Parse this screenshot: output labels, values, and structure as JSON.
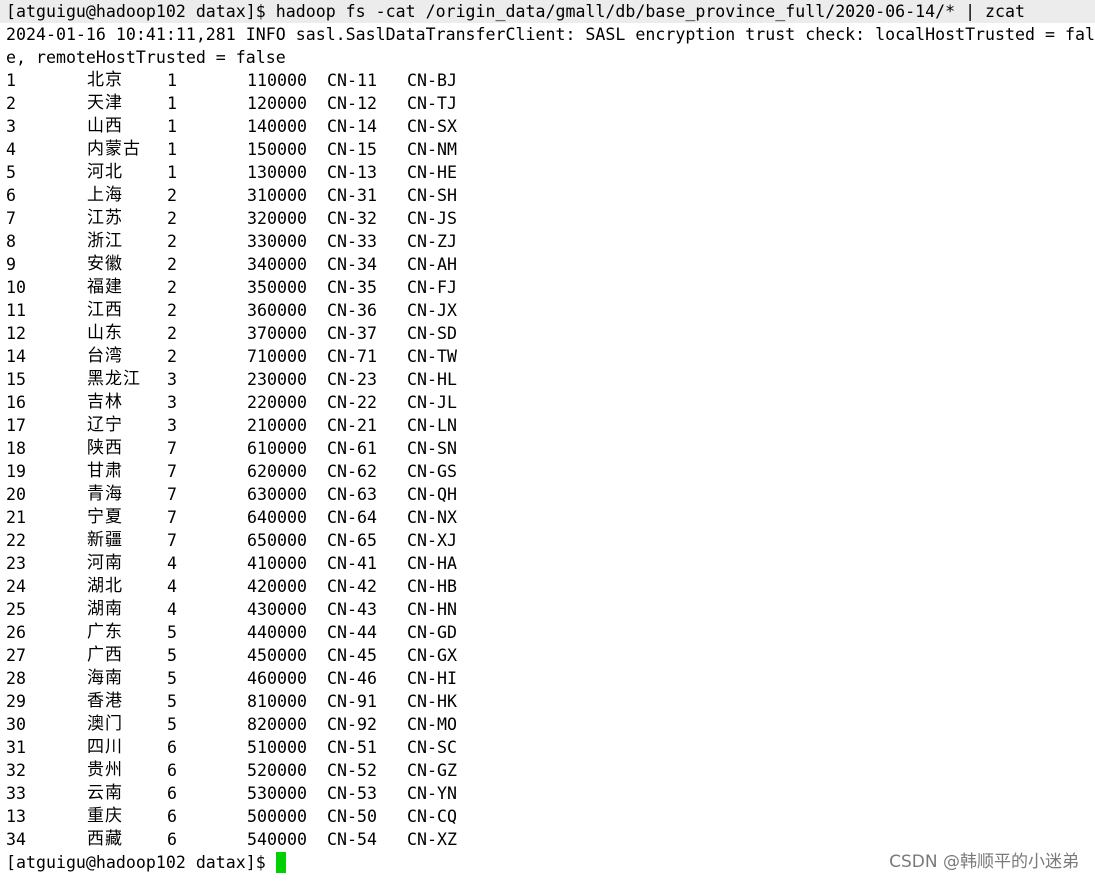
{
  "terminal": {
    "command_line": "[atguigu@hadoop102 datax]$ hadoop fs -cat /origin_data/gmall/db/base_province_full/2020-06-14/* | zcat",
    "log_line_1": "2024-01-16 10:41:11,281 INFO sasl.SaslDataTransferClient: SASL encryption trust check: localHostTrusted = fal",
    "log_line_2": "e, remoteHostTrusted = false",
    "rows": [
      {
        "id": "1",
        "name": "北京",
        "region": "1",
        "area_code": "110000",
        "iso_code": "CN-11",
        "iso_3166_2": "CN-BJ"
      },
      {
        "id": "2",
        "name": "天津",
        "region": "1",
        "area_code": "120000",
        "iso_code": "CN-12",
        "iso_3166_2": "CN-TJ"
      },
      {
        "id": "3",
        "name": "山西",
        "region": "1",
        "area_code": "140000",
        "iso_code": "CN-14",
        "iso_3166_2": "CN-SX"
      },
      {
        "id": "4",
        "name": "内蒙古",
        "region": "1",
        "area_code": "150000",
        "iso_code": "CN-15",
        "iso_3166_2": "CN-NM"
      },
      {
        "id": "5",
        "name": "河北",
        "region": "1",
        "area_code": "130000",
        "iso_code": "CN-13",
        "iso_3166_2": "CN-HE"
      },
      {
        "id": "6",
        "name": "上海",
        "region": "2",
        "area_code": "310000",
        "iso_code": "CN-31",
        "iso_3166_2": "CN-SH"
      },
      {
        "id": "7",
        "name": "江苏",
        "region": "2",
        "area_code": "320000",
        "iso_code": "CN-32",
        "iso_3166_2": "CN-JS"
      },
      {
        "id": "8",
        "name": "浙江",
        "region": "2",
        "area_code": "330000",
        "iso_code": "CN-33",
        "iso_3166_2": "CN-ZJ"
      },
      {
        "id": "9",
        "name": "安徽",
        "region": "2",
        "area_code": "340000",
        "iso_code": "CN-34",
        "iso_3166_2": "CN-AH"
      },
      {
        "id": "10",
        "name": "福建",
        "region": "2",
        "area_code": "350000",
        "iso_code": "CN-35",
        "iso_3166_2": "CN-FJ"
      },
      {
        "id": "11",
        "name": "江西",
        "region": "2",
        "area_code": "360000",
        "iso_code": "CN-36",
        "iso_3166_2": "CN-JX"
      },
      {
        "id": "12",
        "name": "山东",
        "region": "2",
        "area_code": "370000",
        "iso_code": "CN-37",
        "iso_3166_2": "CN-SD"
      },
      {
        "id": "14",
        "name": "台湾",
        "region": "2",
        "area_code": "710000",
        "iso_code": "CN-71",
        "iso_3166_2": "CN-TW"
      },
      {
        "id": "15",
        "name": "黑龙江",
        "region": "3",
        "area_code": "230000",
        "iso_code": "CN-23",
        "iso_3166_2": "CN-HL"
      },
      {
        "id": "16",
        "name": "吉林",
        "region": "3",
        "area_code": "220000",
        "iso_code": "CN-22",
        "iso_3166_2": "CN-JL"
      },
      {
        "id": "17",
        "name": "辽宁",
        "region": "3",
        "area_code": "210000",
        "iso_code": "CN-21",
        "iso_3166_2": "CN-LN"
      },
      {
        "id": "18",
        "name": "陕西",
        "region": "7",
        "area_code": "610000",
        "iso_code": "CN-61",
        "iso_3166_2": "CN-SN"
      },
      {
        "id": "19",
        "name": "甘肃",
        "region": "7",
        "area_code": "620000",
        "iso_code": "CN-62",
        "iso_3166_2": "CN-GS"
      },
      {
        "id": "20",
        "name": "青海",
        "region": "7",
        "area_code": "630000",
        "iso_code": "CN-63",
        "iso_3166_2": "CN-QH"
      },
      {
        "id": "21",
        "name": "宁夏",
        "region": "7",
        "area_code": "640000",
        "iso_code": "CN-64",
        "iso_3166_2": "CN-NX"
      },
      {
        "id": "22",
        "name": "新疆",
        "region": "7",
        "area_code": "650000",
        "iso_code": "CN-65",
        "iso_3166_2": "CN-XJ"
      },
      {
        "id": "23",
        "name": "河南",
        "region": "4",
        "area_code": "410000",
        "iso_code": "CN-41",
        "iso_3166_2": "CN-HA"
      },
      {
        "id": "24",
        "name": "湖北",
        "region": "4",
        "area_code": "420000",
        "iso_code": "CN-42",
        "iso_3166_2": "CN-HB"
      },
      {
        "id": "25",
        "name": "湖南",
        "region": "4",
        "area_code": "430000",
        "iso_code": "CN-43",
        "iso_3166_2": "CN-HN"
      },
      {
        "id": "26",
        "name": "广东",
        "region": "5",
        "area_code": "440000",
        "iso_code": "CN-44",
        "iso_3166_2": "CN-GD"
      },
      {
        "id": "27",
        "name": "广西",
        "region": "5",
        "area_code": "450000",
        "iso_code": "CN-45",
        "iso_3166_2": "CN-GX"
      },
      {
        "id": "28",
        "name": "海南",
        "region": "5",
        "area_code": "460000",
        "iso_code": "CN-46",
        "iso_3166_2": "CN-HI"
      },
      {
        "id": "29",
        "name": "香港",
        "region": "5",
        "area_code": "810000",
        "iso_code": "CN-91",
        "iso_3166_2": "CN-HK"
      },
      {
        "id": "30",
        "name": "澳门",
        "region": "5",
        "area_code": "820000",
        "iso_code": "CN-92",
        "iso_3166_2": "CN-MO"
      },
      {
        "id": "31",
        "name": "四川",
        "region": "6",
        "area_code": "510000",
        "iso_code": "CN-51",
        "iso_3166_2": "CN-SC"
      },
      {
        "id": "32",
        "name": "贵州",
        "region": "6",
        "area_code": "520000",
        "iso_code": "CN-52",
        "iso_3166_2": "CN-GZ"
      },
      {
        "id": "33",
        "name": "云南",
        "region": "6",
        "area_code": "530000",
        "iso_code": "CN-53",
        "iso_3166_2": "CN-YN"
      },
      {
        "id": "13",
        "name": "重庆",
        "region": "6",
        "area_code": "500000",
        "iso_code": "CN-50",
        "iso_3166_2": "CN-CQ"
      },
      {
        "id": "34",
        "name": "西藏",
        "region": "6",
        "area_code": "540000",
        "iso_code": "CN-54",
        "iso_3166_2": "CN-XZ"
      }
    ],
    "prompt": "[atguigu@hadoop102 datax]$",
    "cursor_color": "#00d000"
  },
  "watermark": {
    "text": "CSDN @韩顺平的小迷弟"
  }
}
